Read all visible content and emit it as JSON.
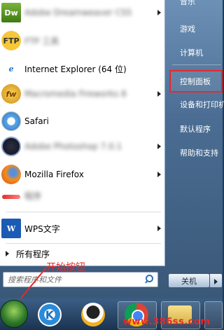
{
  "programs": [
    {
      "name": "Adobe Dreamweaver CS5",
      "icon": "dreamweaver-icon",
      "blurred": true,
      "arrow": true
    },
    {
      "name": "FTP 工具",
      "icon": "ftp-icon",
      "blurred": true,
      "arrow": false
    },
    {
      "name": "Internet Explorer (64 位)",
      "icon": "internet-explorer-icon",
      "blurred": false,
      "arrow": false
    },
    {
      "name": "Macromedia Fireworks 8",
      "icon": "fireworks-icon",
      "blurred": true,
      "arrow": true
    },
    {
      "name": "Safari",
      "icon": "safari-icon",
      "blurred": false,
      "arrow": false
    },
    {
      "name": "Adobe Photoshop 7.0.1",
      "icon": "photoshop-icon",
      "blurred": true,
      "arrow": true
    },
    {
      "name": "Mozilla Firefox",
      "icon": "firefox-icon",
      "blurred": false,
      "arrow": true
    },
    {
      "name": "程序",
      "icon": "app-icon",
      "blurred": true,
      "arrow": false
    },
    {
      "name": "WPS文字",
      "icon": "wps-writer-icon",
      "blurred": false,
      "arrow": true
    }
  ],
  "all_programs_label": "所有程序",
  "search": {
    "placeholder": "搜索程序和文件"
  },
  "right_items": [
    {
      "label": "音乐",
      "highlight": false
    },
    {
      "label": "游戏",
      "highlight": false
    },
    {
      "label": "计算机",
      "highlight": false
    },
    {
      "label": "控制面板",
      "highlight": true
    },
    {
      "label": "设备和打印机",
      "highlight": false
    },
    {
      "label": "默认程序",
      "highlight": false
    },
    {
      "label": "帮助和支持",
      "highlight": false
    }
  ],
  "shutdown_label": "关机",
  "annotation": {
    "text": "开始按钮",
    "color": "#e62a2a"
  },
  "taskbar": {
    "k_label": "K"
  },
  "watermark": "www.386ss.com",
  "colors": {
    "highlight_border": "#e8282a",
    "panel": "#ffffff",
    "frame": "#4b6d93"
  }
}
